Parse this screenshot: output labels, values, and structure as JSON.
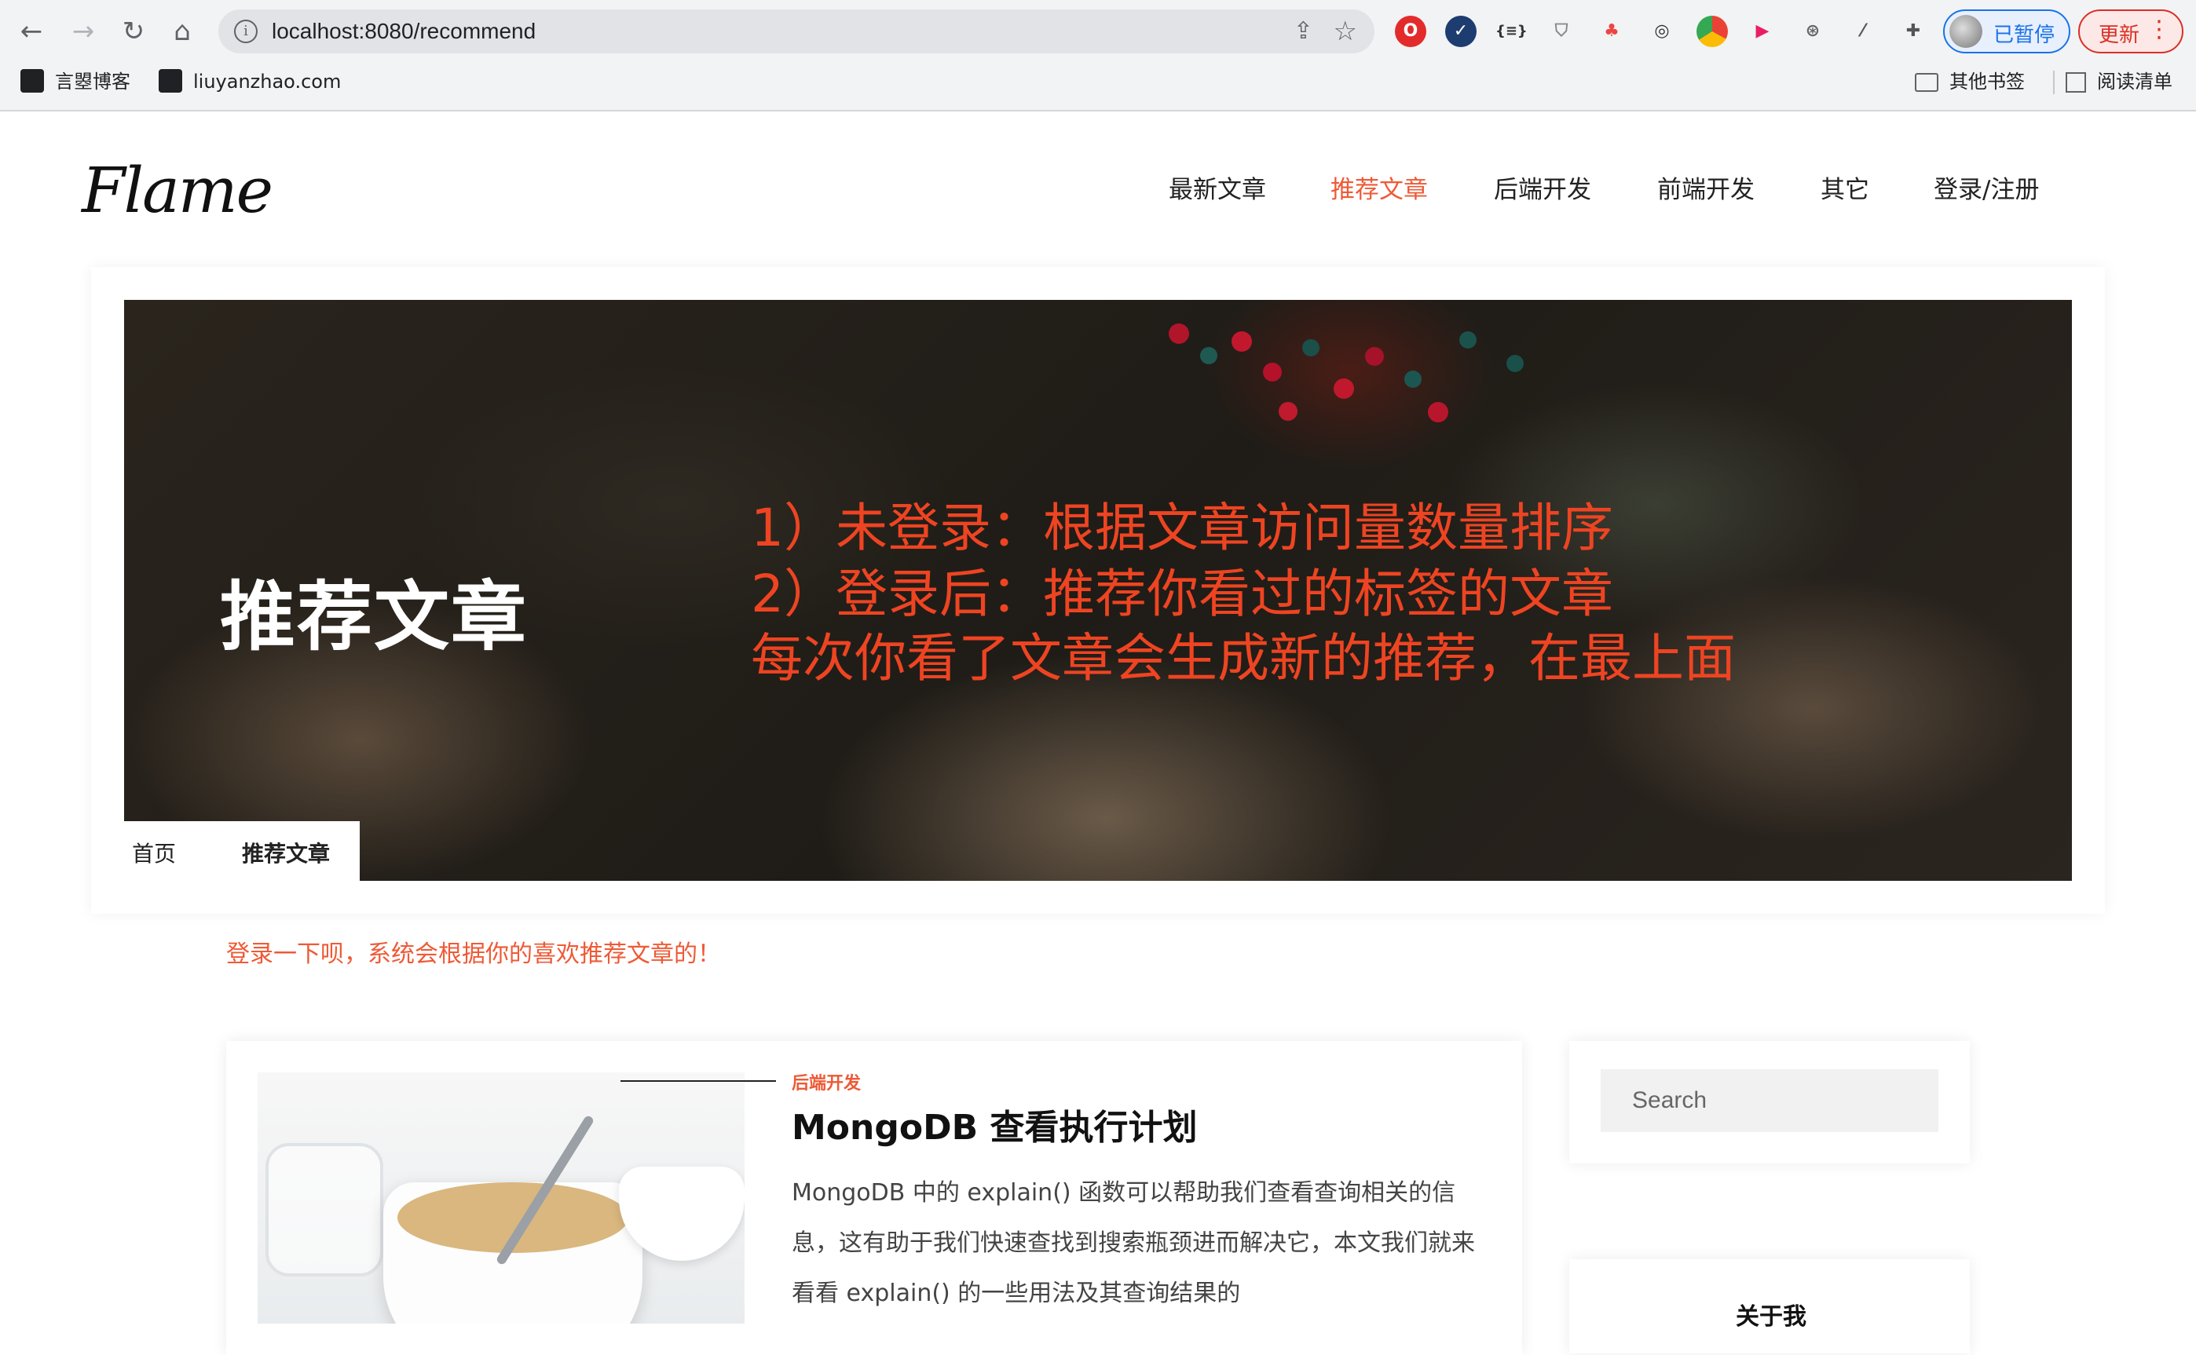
{
  "browser": {
    "url": "localhost:8080/recommend",
    "paused_label": "已暂停",
    "update_label": "更新",
    "bookmarks": [
      "言曌博客",
      "liuyanzhao.com"
    ],
    "other_bookmarks": "其他书签",
    "reading_list": "阅读清单",
    "extension_icons": [
      "opera-icon",
      "checkmark-icon",
      "json-icon",
      "shield-icon",
      "tree-icon",
      "eye-icon",
      "chrome-icon",
      "play-icon",
      "film-icon",
      "eyedropper-icon",
      "puzzle-icon"
    ]
  },
  "site": {
    "logo": "Flame",
    "nav": [
      "最新文章",
      "推荐文章",
      "后端开发",
      "前端开发",
      "其它",
      "登录/注册"
    ],
    "active_nav": "推荐文章",
    "accent_color": "#ee5a36"
  },
  "hero": {
    "title": "推荐文章",
    "note_lines": [
      "1）未登录：根据文章访问量数量排序",
      "2）登录后：推荐你看过的标签的文章",
      "每次你看了文章会生成新的推荐，在最上面"
    ],
    "breadcrumbs": [
      "首页",
      "推荐文章"
    ]
  },
  "login_hint": "登录一下呗，系统会根据你的喜欢推荐文章的！",
  "post": {
    "category": "后端开发",
    "title": "MongoDB 查看执行计划",
    "excerpt": "MongoDB 中的 explain() 函数可以帮助我们查看查询相关的信息，这有助于我们快速查找到搜索瓶颈进而解决它，本文我们就来看看 explain() 的一些用法及其查询结果的"
  },
  "sidebar": {
    "search_placeholder": "Search",
    "about_title": "关于我"
  }
}
